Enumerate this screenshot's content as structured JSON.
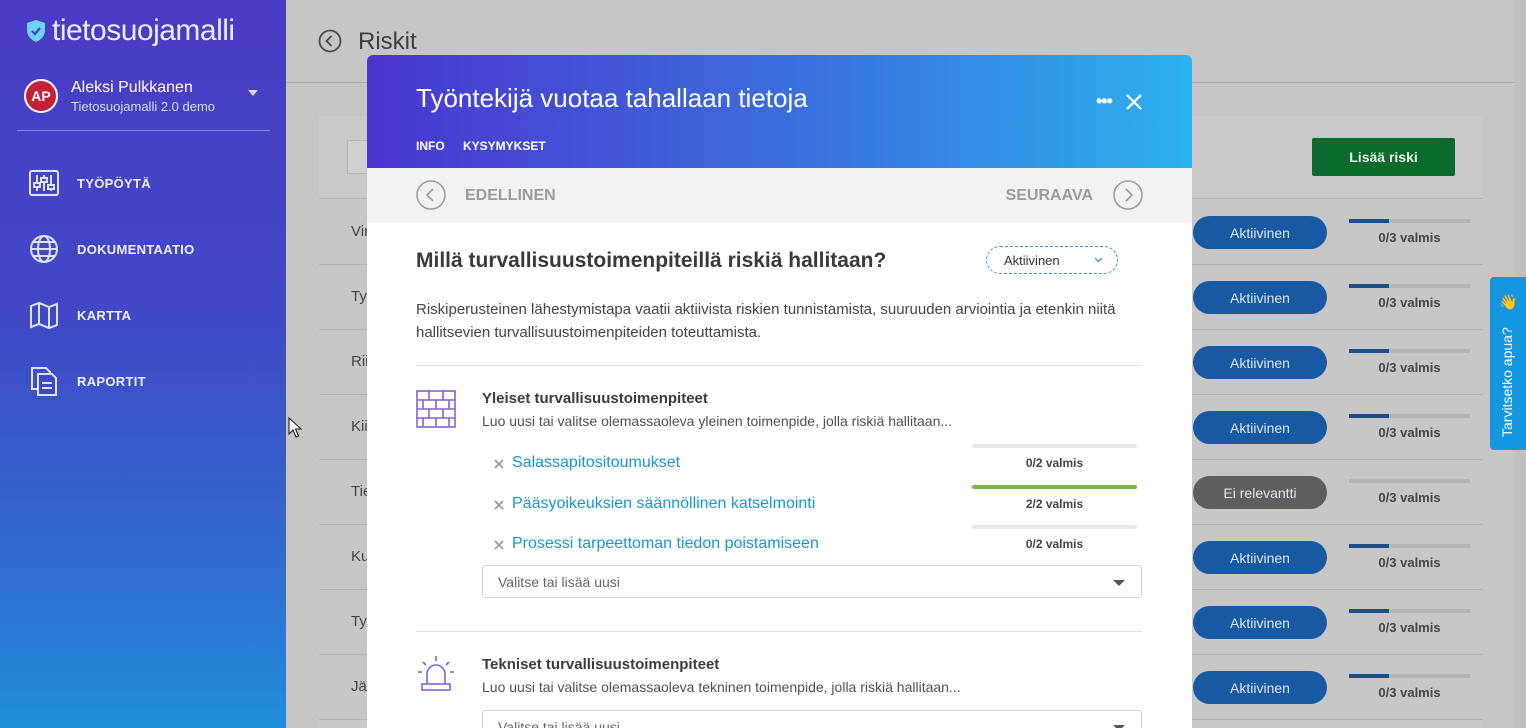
{
  "app": {
    "logo_text": "tietosuojamalli",
    "user_initials": "AP",
    "user_name": "Aleksi Pulkkanen",
    "user_org": "Tietosuojamalli 2.0 demo"
  },
  "sidebar": {
    "items": [
      {
        "label": "TYÖPÖYTÄ",
        "icon": "sliders-icon"
      },
      {
        "label": "DOKUMENTAATIO",
        "icon": "globe-icon"
      },
      {
        "label": "KARTTA",
        "icon": "map-icon"
      },
      {
        "label": "RAPORTIT",
        "icon": "documents-icon"
      }
    ]
  },
  "page": {
    "title": "Riskit",
    "add_button": "Lisää riski"
  },
  "risk_rows": [
    {
      "name": "Vir",
      "status": "Aktiivinen",
      "status_color": "#1859a4",
      "progress_text": "0/3 valmis",
      "progress": 0.33
    },
    {
      "name": "Ty",
      "status": "Aktiivinen",
      "status_color": "#1859a4",
      "progress_text": "0/3 valmis",
      "progress": 0.33
    },
    {
      "name": "Rii",
      "status": "Aktiivinen",
      "status_color": "#1859a4",
      "progress_text": "0/3 valmis",
      "progress": 0.33
    },
    {
      "name": "Kii",
      "status": "Aktiivinen",
      "status_color": "#1859a4",
      "progress_text": "0/3 valmis",
      "progress": 0.33
    },
    {
      "name": "Tie",
      "status": "Ei relevantti",
      "status_color": "#5e5e5e",
      "progress_text": "0/3 valmis",
      "progress": 0
    },
    {
      "name": "Ku",
      "status": "Aktiivinen",
      "status_color": "#1859a4",
      "progress_text": "0/3 valmis",
      "progress": 0.33
    },
    {
      "name": "Ty",
      "status": "Aktiivinen",
      "status_color": "#1859a4",
      "progress_text": "0/3 valmis",
      "progress": 0.33
    },
    {
      "name": "Jär",
      "status": "Aktiivinen",
      "status_color": "#1859a4",
      "progress_text": "0/3 valmis",
      "progress": 0.33
    }
  ],
  "help": {
    "label": "Tarvitsetko apua?",
    "emoji": "👋"
  },
  "modal": {
    "title": "Työntekijä vuotaa tahallaan tietoja",
    "tabs": [
      "INFO",
      "KYSYMYKSET"
    ],
    "prev_label": "EDELLINEN",
    "next_label": "SEURAAVA",
    "question": "Millä turvallisuustoimenpiteillä riskiä hallitaan?",
    "status_value": "Aktiivinen",
    "description": "Riskiperusteinen lähestymistapa vaatii aktiivista riskien tunnistamista, suuruuden arviointia ja etenkin niitä hallitsevien turvallisuustoimenpiteiden toteuttamista.",
    "general": {
      "title": "Yleiset turvallisuustoimenpiteet",
      "desc": "Luo uusi tai valitse olemassaoleva yleinen toimenpide, jolla riskiä hallitaan...",
      "placeholder": "Valitse tai lisää uusi",
      "measures": [
        {
          "name": "Salassapitositoumukset",
          "progress_text": "0/2 valmis",
          "progress": 0
        },
        {
          "name": "Pääsyoikeuksien säännöllinen katselmointi",
          "progress_text": "2/2 valmis",
          "progress": 1
        },
        {
          "name": "Prosessi tarpeettoman tiedon poistamiseen",
          "progress_text": "0/2 valmis",
          "progress": 0
        }
      ]
    },
    "technical": {
      "title": "Tekniset turvallisuustoimenpiteet",
      "desc": "Luo uusi tai valitse olemassaoleva tekninen toimenpide, jolla riskiä hallitaan...",
      "placeholder": "Valitse tai lisää uusi"
    }
  }
}
